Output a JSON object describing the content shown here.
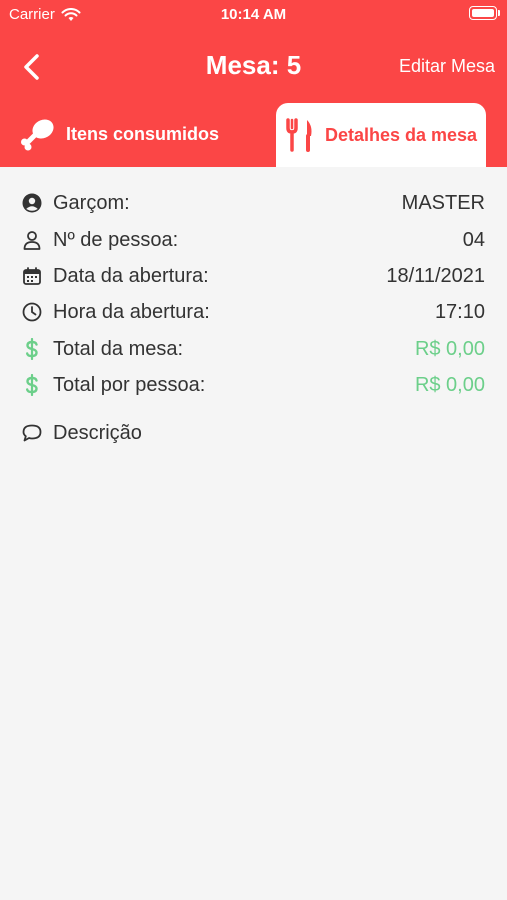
{
  "status_bar": {
    "carrier": "Carrier",
    "time": "10:14 AM"
  },
  "nav": {
    "title": "Mesa: 5",
    "edit_label": "Editar Mesa"
  },
  "tabs": [
    {
      "label": "Itens consumidos",
      "icon": "chicken-leg-icon",
      "active": false
    },
    {
      "label": "Detalhes da mesa",
      "icon": "fork-knife-icon",
      "active": true
    }
  ],
  "details": {
    "garcom": {
      "label": "Garçom:",
      "value": "MASTER",
      "icon": "person-circle-icon"
    },
    "pessoas": {
      "label": "Nº de pessoa:",
      "value": "04",
      "icon": "person-outline-icon"
    },
    "data": {
      "label": "Data da abertura:",
      "value": "18/11/2021",
      "icon": "calendar-icon"
    },
    "hora": {
      "label": "Hora da abertura:",
      "value": "17:10",
      "icon": "clock-icon"
    },
    "total_mesa": {
      "label": "Total da mesa:",
      "value": "R$ 0,00",
      "icon": "dollar-icon"
    },
    "total_pessoa": {
      "label": "Total por pessoa:",
      "value": "R$ 0,00",
      "icon": "dollar-icon"
    },
    "descricao": {
      "label": "Descrição",
      "icon": "speech-bubble-icon"
    }
  },
  "colors": {
    "brand": "#fb4646",
    "money": "#6ccf8a",
    "text": "#333333",
    "background": "#f5f5f5"
  }
}
